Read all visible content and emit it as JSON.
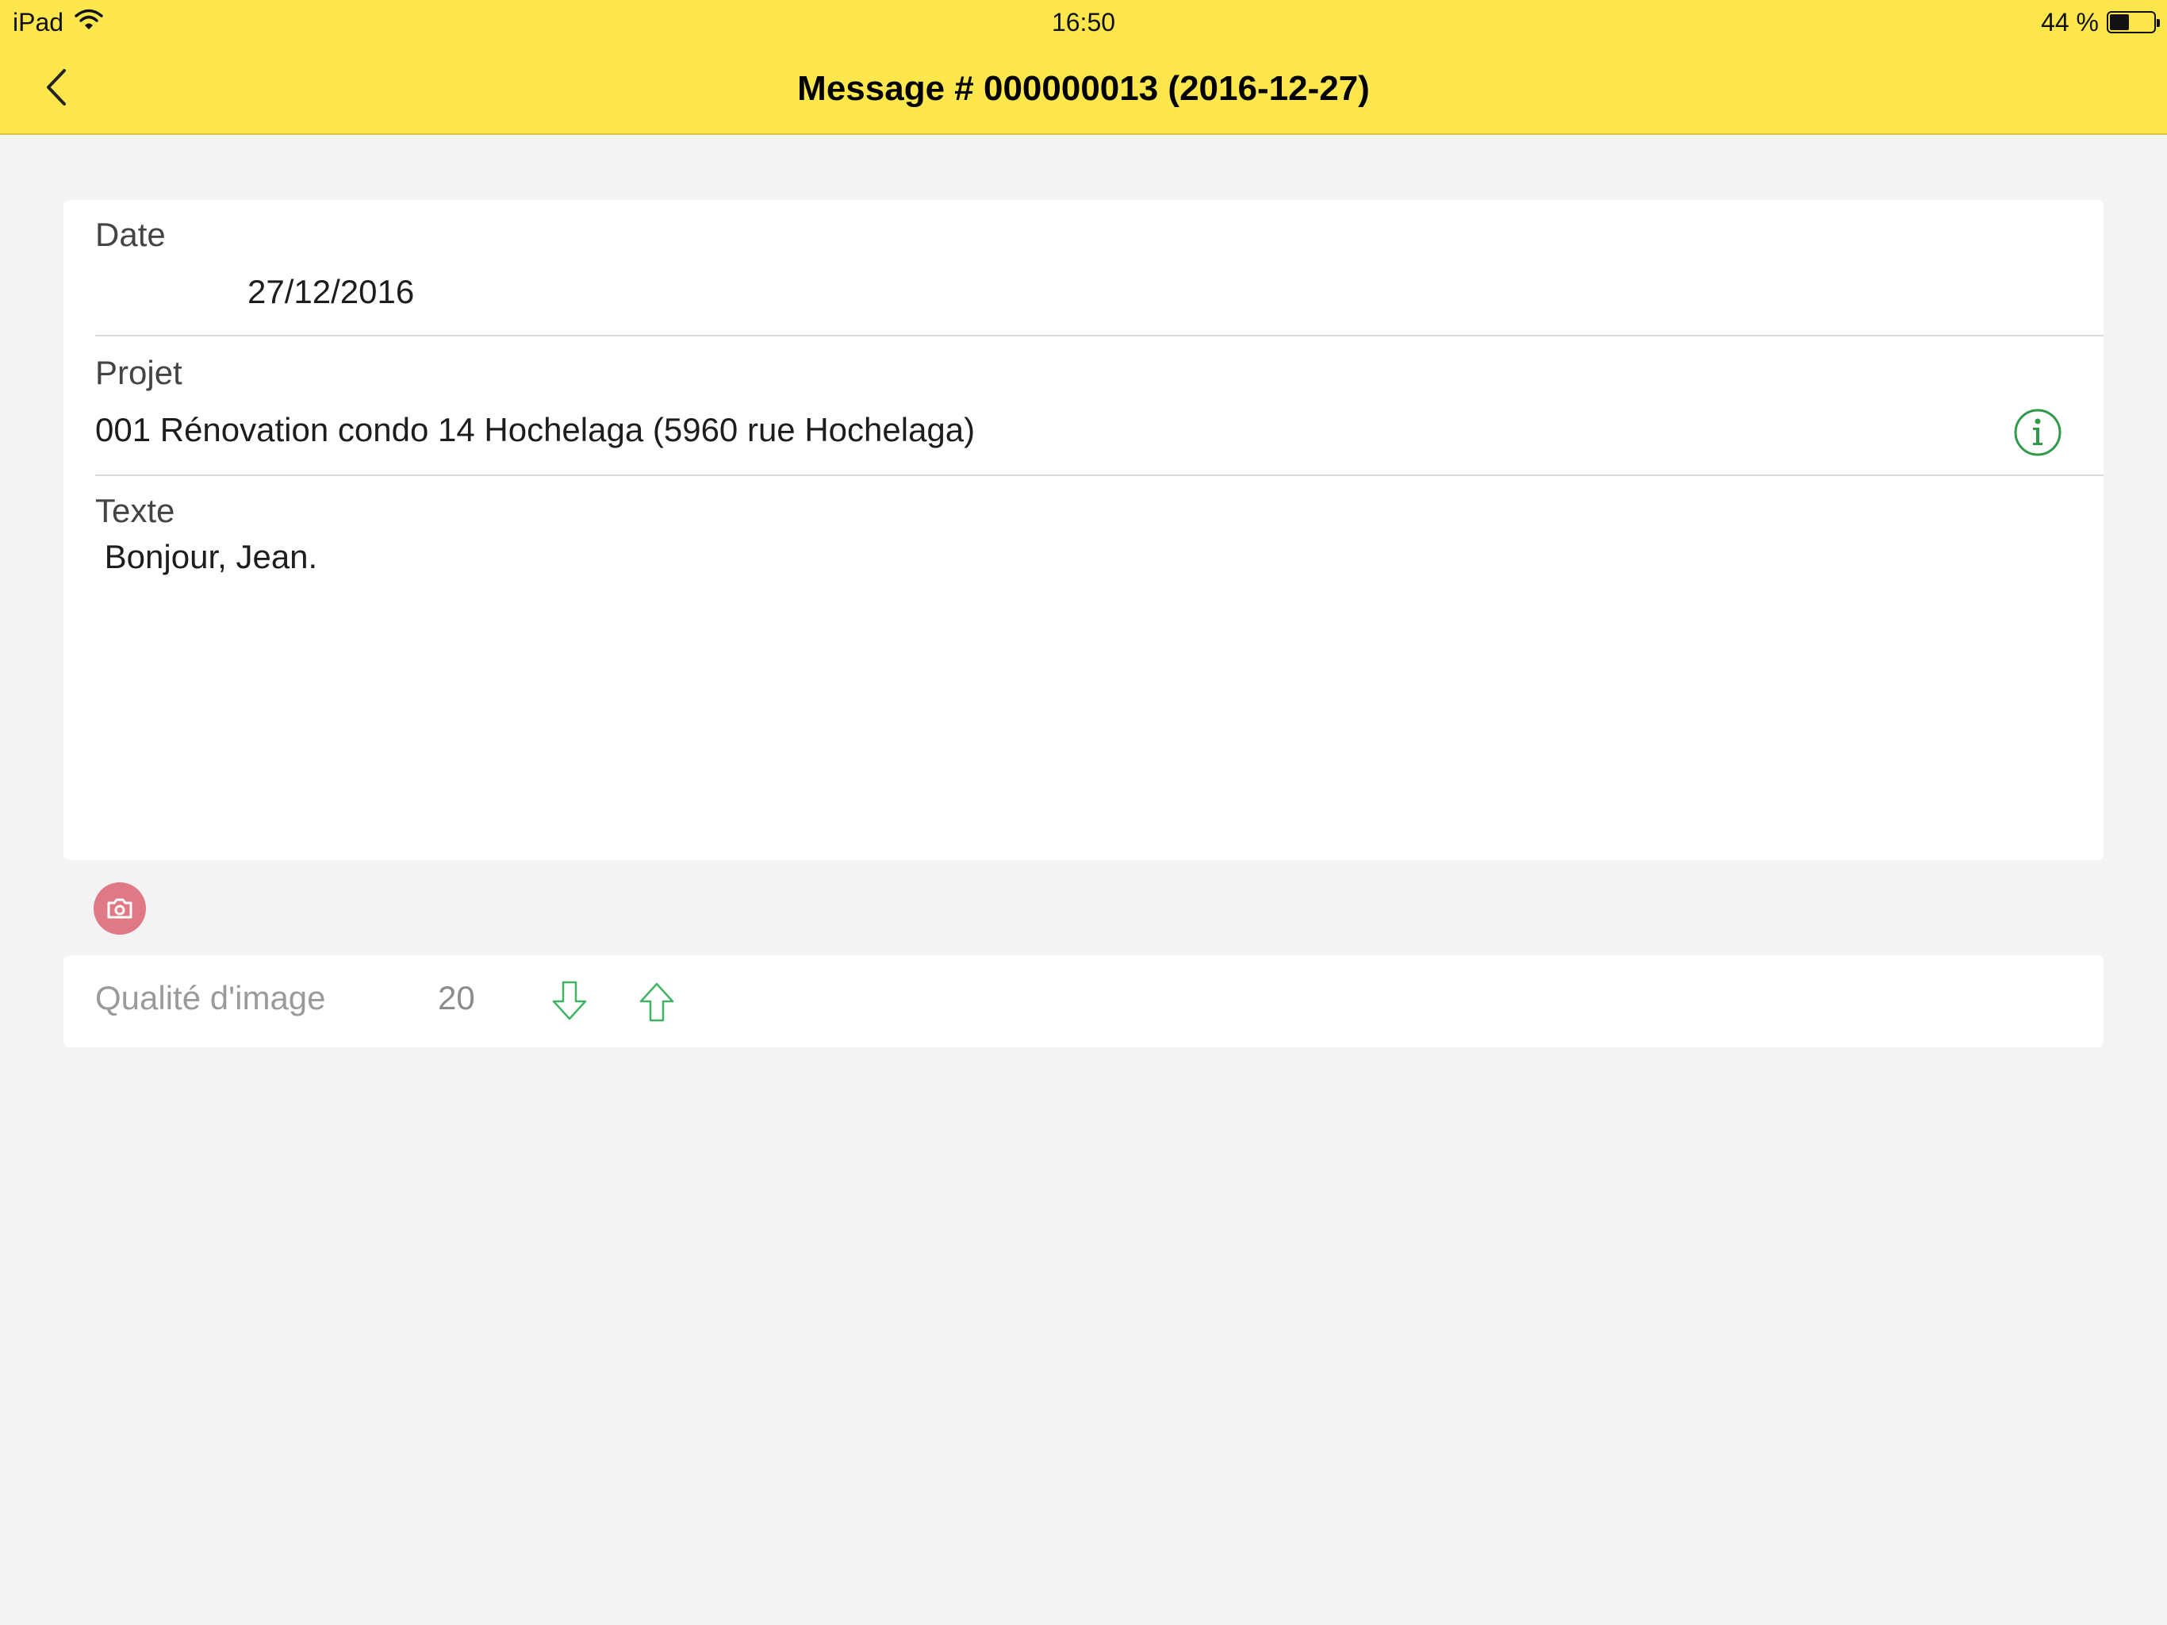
{
  "status_bar": {
    "device": "iPad",
    "time": "16:50",
    "battery": "44 %",
    "battery_level": 0.44
  },
  "nav": {
    "title": "Message # 000000013 (2016-12-27)",
    "back_icon": "chevron-left-icon"
  },
  "form": {
    "date": {
      "label": "Date",
      "value": "27/12/2016"
    },
    "project": {
      "label": "Projet",
      "value": "001 Rénovation condo 14 Hochelaga (5960 rue Hochelaga)",
      "info_icon": "info-circle-icon"
    },
    "text": {
      "label": "Texte",
      "value": " Bonjour, Jean."
    }
  },
  "camera": {
    "icon": "camera-icon"
  },
  "quality": {
    "label": "Qualité d'image",
    "value": "20",
    "decrease_icon": "arrow-down-icon",
    "increase_icon": "arrow-up-icon"
  },
  "colors": {
    "nav_bg": "#fde74d",
    "accent_green": "#2e9a4a",
    "camera_bg": "#e07986"
  }
}
